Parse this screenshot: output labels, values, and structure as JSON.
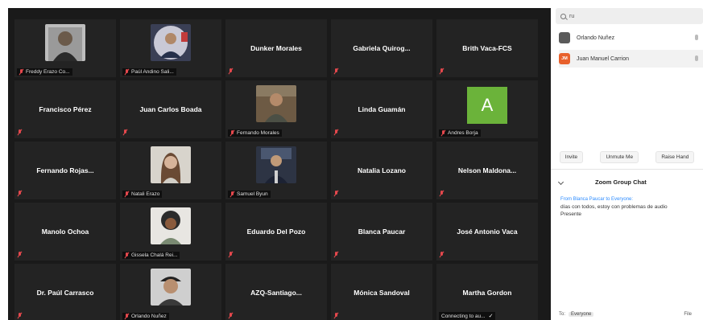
{
  "tiles": [
    {
      "name": "",
      "caption": "Freddy Erazo Co...",
      "photo": "portrait-dark"
    },
    {
      "name": "",
      "caption": "Paúl Andino Sali...",
      "photo": "portrait-round"
    },
    {
      "name": "Dunker Morales",
      "caption": ""
    },
    {
      "name": "Gabriela  Quirog...",
      "caption": ""
    },
    {
      "name": "Brith Vaca-FCS",
      "caption": ""
    },
    {
      "name": "Francisco Pérez",
      "caption": ""
    },
    {
      "name": "Juan Carlos Boada",
      "caption": ""
    },
    {
      "name": "",
      "caption": "Fernando Morales",
      "photo": "portrait-room"
    },
    {
      "name": "Linda Guamán",
      "caption": ""
    },
    {
      "name": "",
      "caption": "Andres Borja",
      "letter": "A"
    },
    {
      "name": "Fernando  Rojas...",
      "caption": ""
    },
    {
      "name": "",
      "caption": "Natali Erazo",
      "photo": "portrait-woman"
    },
    {
      "name": "",
      "caption": "Samuel Byun",
      "photo": "portrait-suit"
    },
    {
      "name": "Natalia Lozano",
      "caption": ""
    },
    {
      "name": "Nelson  Maldona...",
      "caption": ""
    },
    {
      "name": "Manolo Ochoa",
      "caption": ""
    },
    {
      "name": "",
      "caption": "Gissela Chalá Rei...",
      "photo": "portrait-curly"
    },
    {
      "name": "Eduardo Del Pozo",
      "caption": ""
    },
    {
      "name": "Blanca Paucar",
      "caption": ""
    },
    {
      "name": "José Antonio Vaca",
      "caption": ""
    },
    {
      "name": "Dr. Paúl Carrasco",
      "caption": ""
    },
    {
      "name": "",
      "caption": "Orlando Nuñez",
      "photo": "portrait-cap"
    },
    {
      "name": "AZQ-Santiago...",
      "caption": ""
    },
    {
      "name": "Mónica Sandoval",
      "caption": ""
    },
    {
      "name": "Martha Gordon",
      "caption": "Connecting to au...",
      "check": "✓"
    }
  ],
  "panel": {
    "search_value": "ru",
    "participants": [
      {
        "name": "Orlando Nuñez",
        "avatar_text": "",
        "avatar_color": "#5a5a5a"
      },
      {
        "name": "Juan Manuel Carrion",
        "avatar_text": "JM",
        "avatar_color": "#e8612c"
      }
    ],
    "buttons": {
      "invite": "Invite",
      "unmute": "Unmute Me",
      "raise_hand": "Raise Hand"
    },
    "chat": {
      "title": "Zoom Group Chat",
      "from_line": "From Blanca Paucar to Everyone:",
      "messages": [
        "días con todos, estoy con problemas de audio",
        "Presente"
      ],
      "to_label": "To:",
      "to_value": "Everyone",
      "tools": "File"
    }
  },
  "colors": {
    "mute": "#e5484d",
    "accent": "#2d8cff",
    "avatar_green": "#6bb33a"
  }
}
